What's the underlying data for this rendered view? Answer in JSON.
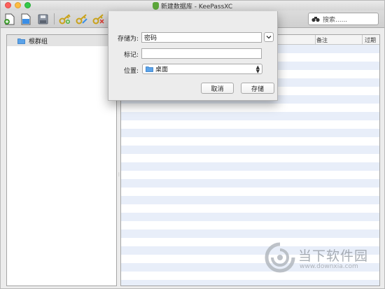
{
  "window": {
    "title": "新建数据库 - KeePassXC"
  },
  "toolbar": {
    "search_placeholder": "搜索......",
    "buttons": [
      "new-database-icon",
      "open-database-icon",
      "save-database-icon",
      "add-entry-icon",
      "edit-entry-icon",
      "delete-entry-icon"
    ]
  },
  "sidebar": {
    "root_group": "根群组"
  },
  "table": {
    "columns": [
      "备注",
      "过期"
    ],
    "stripe_color": "#e8eef9"
  },
  "dialog": {
    "save_as_label": "存储为:",
    "save_as_value": "密码",
    "tags_label": "标记:",
    "tags_value": "",
    "location_label": "位置:",
    "location_value": "桌面",
    "cancel_label": "取消",
    "save_label": "存储"
  },
  "watermark": {
    "text": "当下软件园",
    "url": "www.downxia.com"
  },
  "colors": {
    "accent_blue": "#3a8ee6",
    "close": "#fc605c",
    "minimize": "#fdbc40",
    "maximize": "#34c84a"
  }
}
